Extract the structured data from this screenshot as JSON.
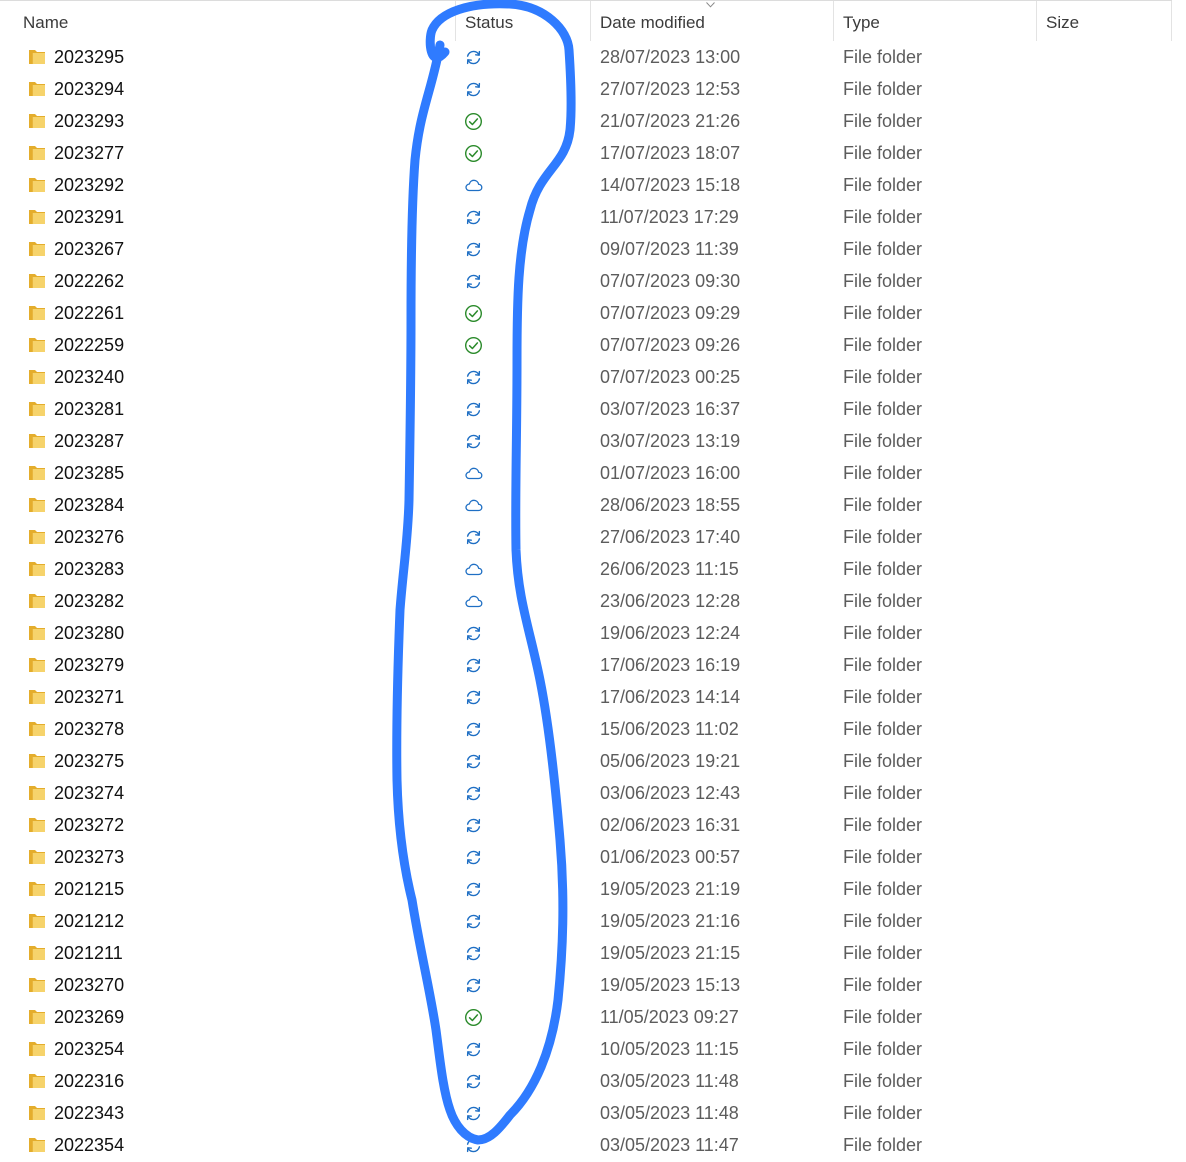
{
  "columns": {
    "name": "Name",
    "status": "Status",
    "date": "Date modified",
    "type": "Type",
    "size": "Size"
  },
  "colors": {
    "sync": "#1f6fc4",
    "ok": "#2a8a2a",
    "cloud": "#1f6fc4",
    "annotation": "#2f7bff",
    "folder": "#f2c95a"
  },
  "rows": [
    {
      "name": "2023295",
      "status": "sync-icon",
      "date": "28/07/2023 13:00",
      "type": "File folder"
    },
    {
      "name": "2023294",
      "status": "sync-icon",
      "date": "27/07/2023 12:53",
      "type": "File folder"
    },
    {
      "name": "2023293",
      "status": "check-icon",
      "date": "21/07/2023 21:26",
      "type": "File folder"
    },
    {
      "name": "2023277",
      "status": "check-icon",
      "date": "17/07/2023 18:07",
      "type": "File folder"
    },
    {
      "name": "2023292",
      "status": "cloud-icon",
      "date": "14/07/2023 15:18",
      "type": "File folder"
    },
    {
      "name": "2023291",
      "status": "sync-icon",
      "date": "11/07/2023 17:29",
      "type": "File folder"
    },
    {
      "name": "2023267",
      "status": "sync-icon",
      "date": "09/07/2023 11:39",
      "type": "File folder"
    },
    {
      "name": "2022262",
      "status": "sync-icon",
      "date": "07/07/2023 09:30",
      "type": "File folder"
    },
    {
      "name": "2022261",
      "status": "check-icon",
      "date": "07/07/2023 09:29",
      "type": "File folder"
    },
    {
      "name": "2022259",
      "status": "check-icon",
      "date": "07/07/2023 09:26",
      "type": "File folder"
    },
    {
      "name": "2023240",
      "status": "sync-icon",
      "date": "07/07/2023 00:25",
      "type": "File folder"
    },
    {
      "name": "2023281",
      "status": "sync-icon",
      "date": "03/07/2023 16:37",
      "type": "File folder"
    },
    {
      "name": "2023287",
      "status": "sync-icon",
      "date": "03/07/2023 13:19",
      "type": "File folder"
    },
    {
      "name": "2023285",
      "status": "cloud-icon",
      "date": "01/07/2023 16:00",
      "type": "File folder"
    },
    {
      "name": "2023284",
      "status": "cloud-icon",
      "date": "28/06/2023 18:55",
      "type": "File folder"
    },
    {
      "name": "2023276",
      "status": "sync-icon",
      "date": "27/06/2023 17:40",
      "type": "File folder"
    },
    {
      "name": "2023283",
      "status": "cloud-icon",
      "date": "26/06/2023 11:15",
      "type": "File folder"
    },
    {
      "name": "2023282",
      "status": "cloud-icon",
      "date": "23/06/2023 12:28",
      "type": "File folder"
    },
    {
      "name": "2023280",
      "status": "sync-icon",
      "date": "19/06/2023 12:24",
      "type": "File folder"
    },
    {
      "name": "2023279",
      "status": "sync-icon",
      "date": "17/06/2023 16:19",
      "type": "File folder"
    },
    {
      "name": "2023271",
      "status": "sync-icon",
      "date": "17/06/2023 14:14",
      "type": "File folder"
    },
    {
      "name": "2023278",
      "status": "sync-icon",
      "date": "15/06/2023 11:02",
      "type": "File folder"
    },
    {
      "name": "2023275",
      "status": "sync-icon",
      "date": "05/06/2023 19:21",
      "type": "File folder"
    },
    {
      "name": "2023274",
      "status": "sync-icon",
      "date": "03/06/2023 12:43",
      "type": "File folder"
    },
    {
      "name": "2023272",
      "status": "sync-icon",
      "date": "02/06/2023 16:31",
      "type": "File folder"
    },
    {
      "name": "2023273",
      "status": "sync-icon",
      "date": "01/06/2023 00:57",
      "type": "File folder"
    },
    {
      "name": "2021215",
      "status": "sync-icon",
      "date": "19/05/2023 21:19",
      "type": "File folder"
    },
    {
      "name": "2021212",
      "status": "sync-icon",
      "date": "19/05/2023 21:16",
      "type": "File folder"
    },
    {
      "name": "2021211",
      "status": "sync-icon",
      "date": "19/05/2023 21:15",
      "type": "File folder"
    },
    {
      "name": "2023270",
      "status": "sync-icon",
      "date": "19/05/2023 15:13",
      "type": "File folder"
    },
    {
      "name": "2023269",
      "status": "check-icon",
      "date": "11/05/2023 09:27",
      "type": "File folder"
    },
    {
      "name": "2023254",
      "status": "sync-icon",
      "date": "10/05/2023 11:15",
      "type": "File folder"
    },
    {
      "name": "2022316",
      "status": "sync-icon",
      "date": "03/05/2023 11:48",
      "type": "File folder"
    },
    {
      "name": "2022343",
      "status": "sync-icon",
      "date": "03/05/2023 11:48",
      "type": "File folder"
    },
    {
      "name": "2022354",
      "status": "sync-icon",
      "date": "03/05/2023 11:47",
      "type": "File folder"
    }
  ]
}
